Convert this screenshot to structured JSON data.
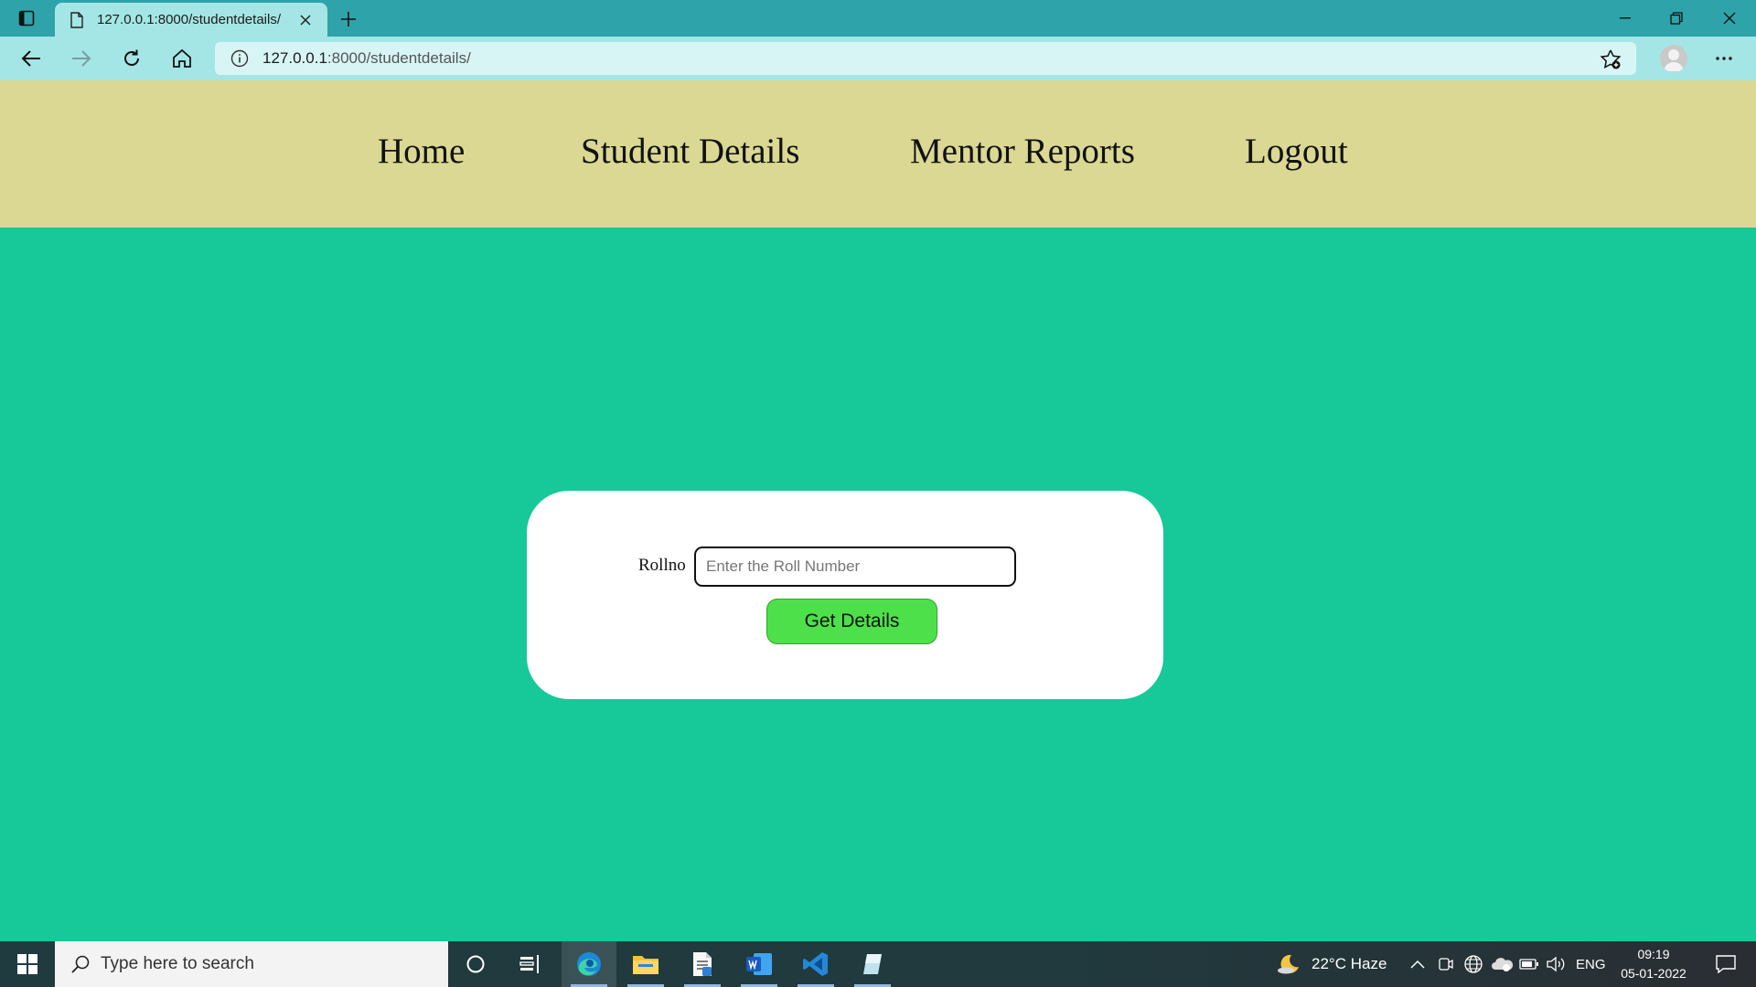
{
  "browser": {
    "tab_title": "127.0.0.1:8000/studentdetails/",
    "url_host": "127.0.0.1",
    "url_rest": ":8000/studentdetails/"
  },
  "nav": {
    "items": [
      {
        "label": "Home"
      },
      {
        "label": "Student Details"
      },
      {
        "label": "Mentor Reports"
      },
      {
        "label": "Logout"
      }
    ]
  },
  "form": {
    "roll_label": "Rollno",
    "roll_placeholder": "Enter the Roll Number",
    "roll_value": "",
    "submit_label": "Get Details"
  },
  "taskbar": {
    "search_placeholder": "Type here to search",
    "weather": "22°C  Haze",
    "language": "ENG",
    "time": "09:19",
    "date": "05-01-2022"
  },
  "colors": {
    "page_bg": "#17c898",
    "nav_bg": "#dad892",
    "button_bg": "#4de04a",
    "browser_frame": "#2ea3aa"
  }
}
